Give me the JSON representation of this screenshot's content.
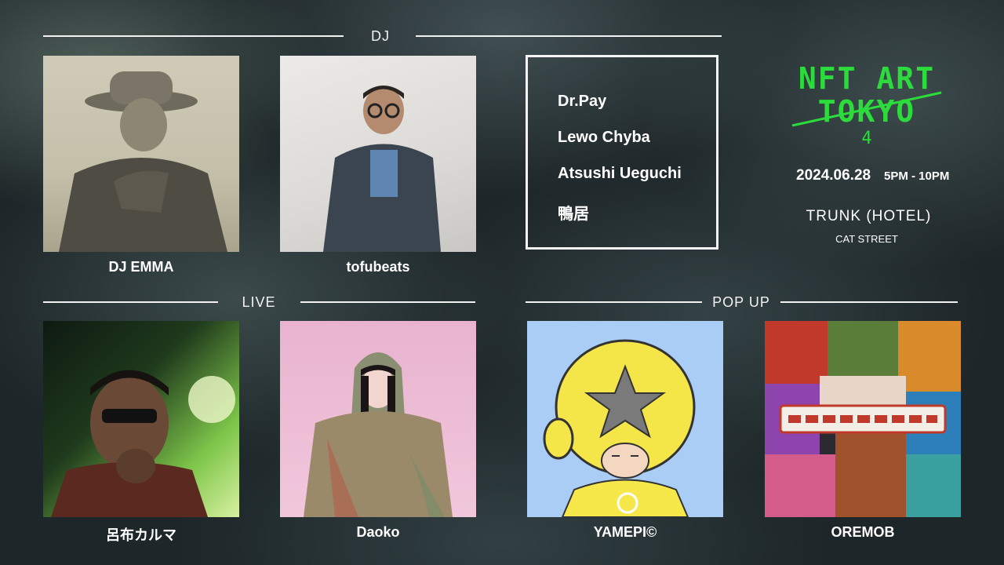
{
  "sections": {
    "dj": "DJ",
    "live": "LIVE",
    "popup": "POP UP"
  },
  "dj_artists": [
    {
      "name": "DJ EMMA"
    },
    {
      "name": "tofubeats"
    }
  ],
  "dj_list": [
    "Dr.Pay",
    "Lewo Chyba",
    "Atsushi Ueguchi",
    "鴨居"
  ],
  "live_artists": [
    {
      "name": "呂布カルマ"
    },
    {
      "name": "Daoko"
    }
  ],
  "popup_artists": [
    {
      "name": "YAMEPI©"
    },
    {
      "name": "OREMOB"
    }
  ],
  "event": {
    "logo_line1": "NFT ART",
    "logo_line2": "TOKYO",
    "logo_line3": "4",
    "date": "2024.06.28",
    "time": "5PM - 10PM",
    "venue": "TRUNK (HOTEL)",
    "venue_sub": "CAT STREET"
  },
  "colors": {
    "accent_green": "#2bdc3c",
    "rule": "#f2f2f2",
    "popup_bg": "#a9cdf5"
  }
}
